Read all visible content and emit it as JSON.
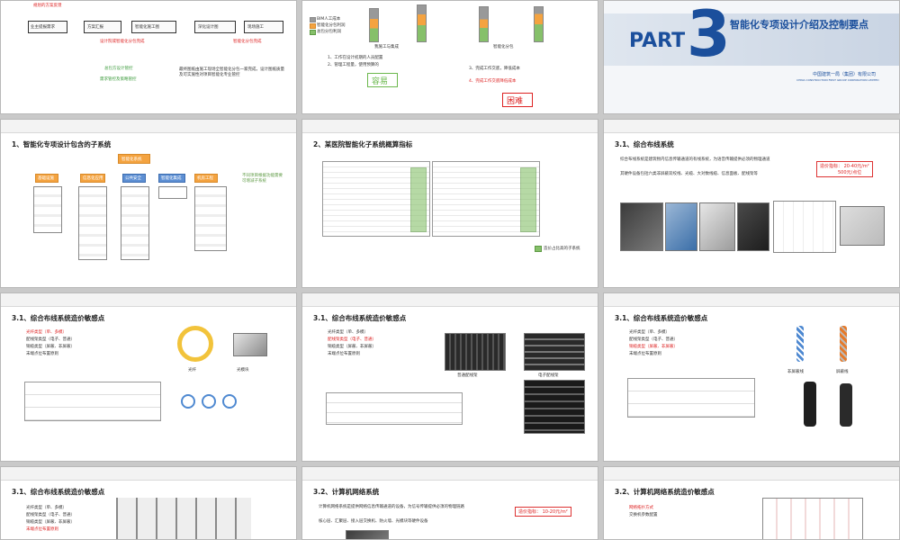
{
  "slides": {
    "s1": {
      "top_note": "规划的方案反馈",
      "box_owner": "业主提报需求",
      "box_solution": "方案汇报",
      "box_construction": "智能化施工图",
      "box_deepen": "深化设计图",
      "box_site": "现场施工",
      "label_plan_review": "设计院或智能化分包完成",
      "label_sub_complete": "智能化分包完成",
      "label_rule_review": "总包方设计管控",
      "label_quality_review": "需求管控及策略管控",
      "note_right": "最终图纸由施工现场全智能化分包一家完成，设计图纸质量及可实施性对项目智能化专业管控"
    },
    "s2": {
      "legend_1": "BIM人工成本",
      "legend_2": "智能化分包利润",
      "legend_3": "总包分包利润",
      "caption_1": "我施工与集成",
      "caption_2": "智能化分包",
      "note_1": "1、工作在设计初期的人员配置",
      "note_2": "2、管理工程量，使用预算的",
      "note_3": "3、完成工作交底，降低成本",
      "note_4": "4、完成工作交底降低成本",
      "label_easy": "容易",
      "label_hard": "困难"
    },
    "s3": {
      "part_word": "PART",
      "part_number": "3",
      "title": "智能化专项设计介绍及控制要点",
      "company_cn": "中国建筑一局（集团）有限公司",
      "company_en": "CHINA CONSTRUCTION FIRST GROUP CORPORATION LIMITED"
    },
    "header_title": "智能化专项设计介绍及控制要点",
    "header_logo": "中国建筑一局（集团）有限公司",
    "s4": {
      "section": "1、智能化专项设计包含的子系统",
      "root": "智能化系统",
      "branch_1": "基础设施",
      "branch_2": "信息化应用",
      "branch_3": "公共安全",
      "branch_4": "智能化集成",
      "branch_5": "机房工程",
      "side_note": "不同项目根据功能需要可增减子系统"
    },
    "s5": {
      "section": "2、某医院智能化子系统概算指标",
      "legend": "造价占比高的子系统"
    },
    "s6": {
      "section": "3.1、综合布线系统",
      "bullet_1": "综合布线系统是建筑物内信息传输通道的有线系统，为语音传输提供必须的物理通道",
      "bullet_2": "其硬件设备包括六类非屏蔽双绞线、光缆、大对数线缆、信息面板、配线架等",
      "price_label": "造价指标：",
      "price_value": "20-40元/m²",
      "price_value2": "500元/点位"
    },
    "s7": {
      "section": "3.1、综合布线系统造价敏感点",
      "bullet_1": "光纤类型（单、多模）",
      "bullet_2": "配线架类型（电子、普通）",
      "bullet_3": "铜缆类型（屏蔽、非屏蔽）",
      "bullet_4": "末端点位布置原则",
      "label_fiber": "光纤",
      "label_module": "光模块"
    },
    "s8": {
      "section": "3.1、综合布线系统造价敏感点",
      "bullet_1": "光纤类型（单、多模）",
      "bullet_2": "配线架类型（电子、普通）",
      "bullet_3": "铜缆类型（屏蔽、非屏蔽）",
      "bullet_4": "末端点位布置原则",
      "label_normal": "普通配线架",
      "label_electronic": "电子配线架"
    },
    "s9": {
      "section": "3.1、综合布线系统造价敏感点",
      "bullet_1": "光纤类型（单、多模）",
      "bullet_2": "配线架类型（电子、普通）",
      "bullet_3": "铜缆类型（屏蔽、非屏蔽）",
      "bullet_4": "末端点位布置原则",
      "label_unshielded": "非屏蔽线",
      "label_shielded": "屏蔽线"
    },
    "s10": {
      "section": "3.1、综合布线系统造价敏感点",
      "bullet_1": "光纤类型（单、多模）",
      "bullet_2": "配线架类型（电子、普通）",
      "bullet_3": "铜缆类型（屏蔽、非屏蔽）",
      "bullet_4": "末端点位布置原则"
    },
    "s11": {
      "section": "3.2、计算机网络系统",
      "bullet_1": "计算机网络系统是提供网络信息传输通道的设备，为信号传输提供必须的物理链路",
      "bullet_2": "核心层、汇聚层、接入层交换机、防火墙、光模块等硬件设备",
      "price_label": "造价指标：",
      "price_value": "10-20元/m²"
    },
    "s12": {
      "section": "3.2、计算机网络系统造价敏感点",
      "bullet_1": "网络拓扑方式",
      "bullet_2": "交换机参数配置"
    }
  },
  "colors": {
    "accent_blue": "#1b4f9c",
    "accent_red": "#d22222",
    "green": "#86c06a",
    "orange": "#f4a340"
  }
}
